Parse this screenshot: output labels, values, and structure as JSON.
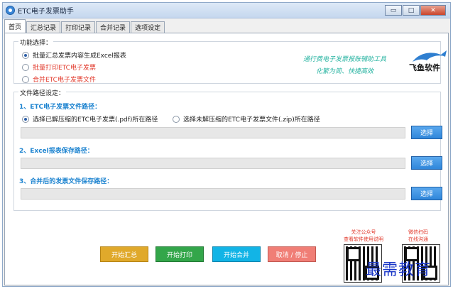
{
  "window": {
    "title": "ETC电子发票助手",
    "controls": {
      "minimize": "▭",
      "maximize": "□",
      "close": "✕"
    }
  },
  "tabs": [
    "首页",
    "汇总记录",
    "打印记录",
    "合并记录",
    "选项设定"
  ],
  "function_select": {
    "title": "功能选择：",
    "options": [
      {
        "label": "批量汇总发票内容生成Excel报表",
        "checked": true,
        "color": "#222222"
      },
      {
        "label": "批量打印ETC电子发票",
        "checked": false,
        "color": "#e23a2c"
      },
      {
        "label": "合并ETC电子发票文件",
        "checked": false,
        "color": "#e23a2c"
      }
    ],
    "slogan_line1": "通行费电子发票报账辅助工具",
    "slogan_line2": "化繁为简、快捷高效",
    "brand": "飞鱼软件"
  },
  "path_settings": {
    "title": "文件路径设定：",
    "sections": [
      {
        "title": "1、ETC电子发票文件路径：",
        "choose_label": "选择"
      },
      {
        "title": "2、Excel报表保存路径：",
        "choose_label": "选择"
      },
      {
        "title": "3、合并后的发票文件保存路径：",
        "choose_label": "选择"
      }
    ],
    "source_options": [
      {
        "label": "选择已解压缩的ETC电子发票(.pdf)所在路径",
        "checked": true
      },
      {
        "label": "选择未解压缩的ETC电子发票文件(.zip)所在路径",
        "checked": false
      }
    ]
  },
  "actions": [
    {
      "label": "开始汇总"
    },
    {
      "label": "开始打印"
    },
    {
      "label": "开始合并"
    },
    {
      "label": "取消 / 停止"
    }
  ],
  "qr_left": {
    "caption_line1": "关注公众号",
    "caption_line2": "查看软件使用说明"
  },
  "qr_right": {
    "caption_line1": "微信扫码",
    "caption_line2": "在线沟通"
  },
  "watermark": "最需教育",
  "colors": {
    "accent_blue": "#1e84d0",
    "red_text": "#e23a2c",
    "slogan": "#2bb5a3"
  }
}
